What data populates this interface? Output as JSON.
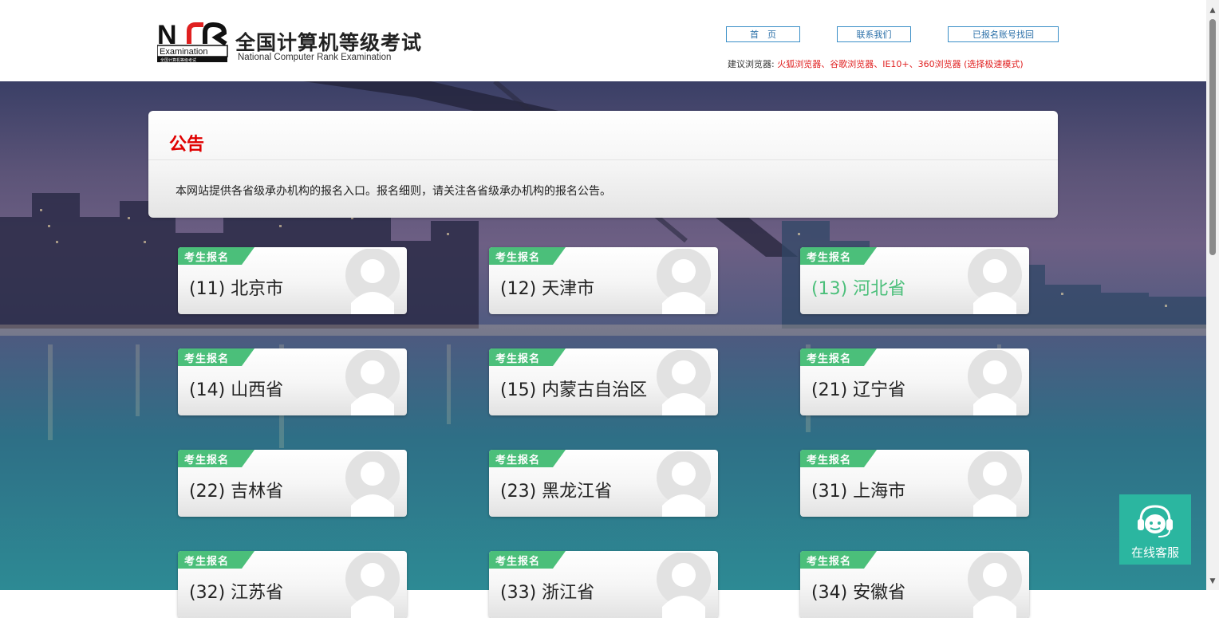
{
  "header": {
    "logo_mark_text": "NCR",
    "logo_small": "Examination",
    "logo_tiny": "全国计算机等级考试",
    "title_cn": "全国计算机等级考试",
    "title_en": "National Computer Rank Examination",
    "nav": {
      "home": "首　页",
      "contact": "联系我们",
      "recover": "已报名账号找回"
    },
    "browser_prefix": "建议浏览器:",
    "browser_list": "火狐浏览器、谷歌浏览器、IE10+、360浏览器 (选择极速模式)"
  },
  "notice": {
    "title": "公告",
    "body": "本网站提供各省级承办机构的报名入口。报名细则，请关注各省级承办机构的报名公告。"
  },
  "card_tag": "考生报名",
  "cards": [
    {
      "name": "(11) 北京市"
    },
    {
      "name": "(12) 天津市"
    },
    {
      "name": "(13) 河北省"
    },
    {
      "name": "(14) 山西省"
    },
    {
      "name": "(15) 内蒙古自治区"
    },
    {
      "name": "(21) 辽宁省"
    },
    {
      "name": "(22) 吉林省"
    },
    {
      "name": "(23) 黑龙江省"
    },
    {
      "name": "(31) 上海市"
    },
    {
      "name": "(32) 江苏省"
    },
    {
      "name": "(33) 浙江省"
    },
    {
      "name": "(34) 安徽省"
    }
  ],
  "service": {
    "label": "在线客服"
  },
  "colors": {
    "accent_green": "#4bbf7a",
    "notice_red": "#e00000",
    "link_blue": "#2a6fa8",
    "service_teal": "#2bb6a0"
  }
}
